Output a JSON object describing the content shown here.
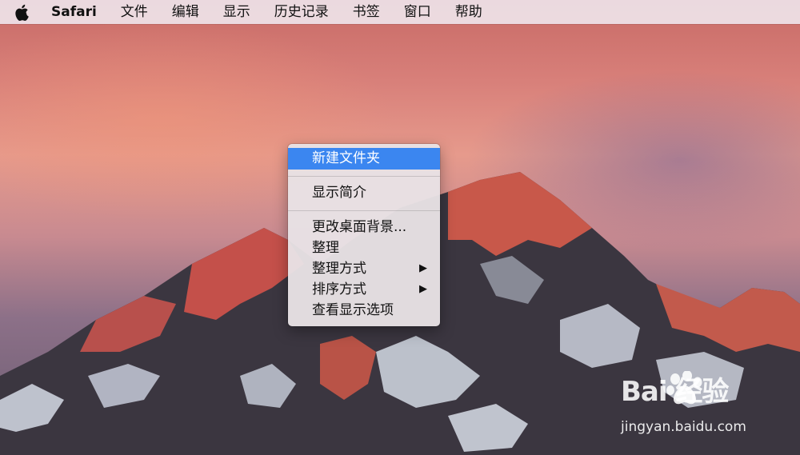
{
  "menubar": {
    "app_name": "Safari",
    "items": [
      "文件",
      "编辑",
      "显示",
      "历史记录",
      "书签",
      "窗口",
      "帮助"
    ]
  },
  "context_menu": {
    "items": [
      {
        "label": "新建文件夹",
        "selected": true
      },
      {
        "label": "显示简介"
      },
      {
        "label": "更改桌面背景..."
      },
      {
        "label": "整理"
      },
      {
        "label": "整理方式",
        "submenu_arrow": "▶"
      },
      {
        "label": "排序方式",
        "submenu_arrow": "▶"
      },
      {
        "label": "查看显示选项"
      }
    ]
  },
  "watermark": {
    "logo_text": "Bai  经验",
    "url": "jingyan.baidu.com"
  },
  "colors": {
    "selection": "#3b86f0",
    "menubar_bg": "#eee2e8"
  },
  "icons": [
    "apple-icon",
    "submenu-arrow-icon",
    "baidu-paw-icon"
  ]
}
